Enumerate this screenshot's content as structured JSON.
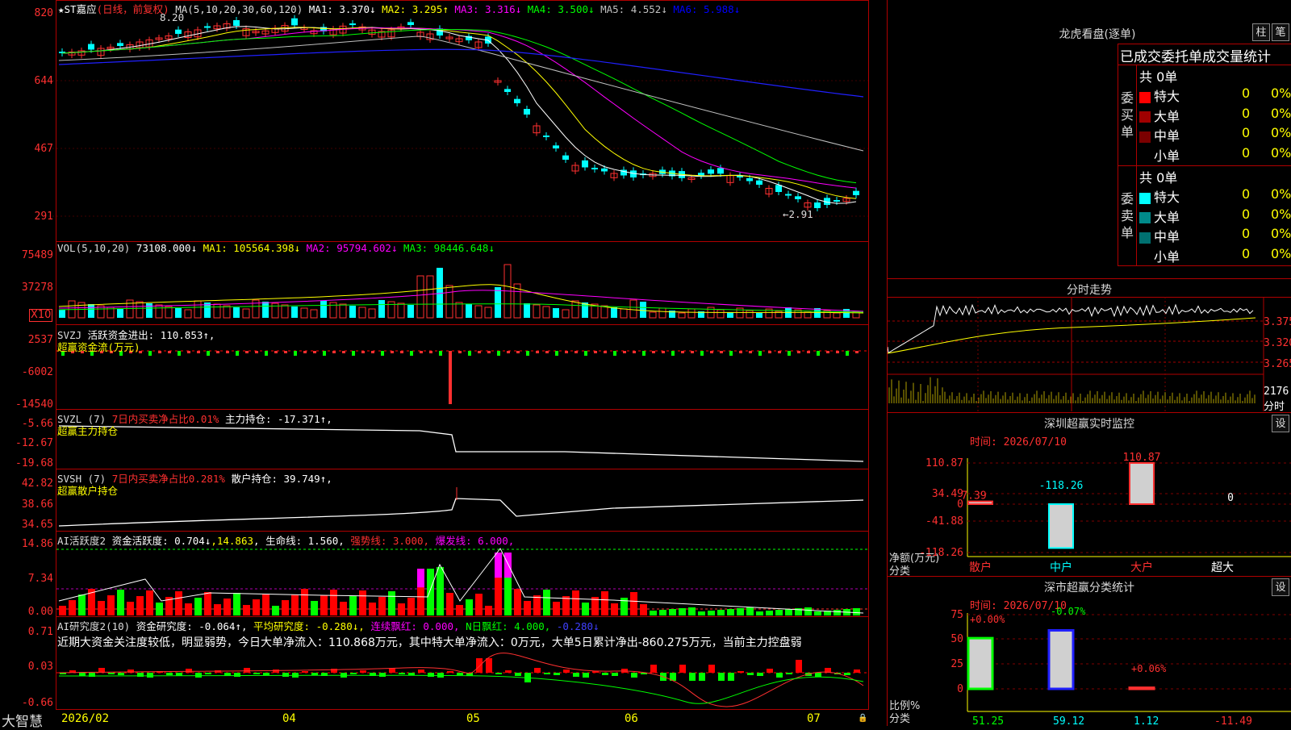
{
  "kline": {
    "name": "ST嘉应",
    "mode": "(日线，前复权)",
    "ma_label": "MA(5,10,20,30,60,120)",
    "ma1": "MA1: 3.370↓",
    "ma2": "MA2: 3.295↑",
    "ma3": "MA3: 3.316↓",
    "ma4": "MA4: 3.500↓",
    "ma5": "MA5: 4.552↓",
    "ma6": "MA6: 5.988↓",
    "yticks": [
      "820",
      "644",
      "467",
      "291"
    ],
    "high_note": "8.20",
    "low_note": "←2.91"
  },
  "vol": {
    "label": "VOL(5,10,20)",
    "v": "73108.000↓",
    "ma1": "MA1: 105564.398↓",
    "ma2": "MA2: 95794.602↓",
    "ma3": "MA3: 98446.648↓",
    "yticks": [
      "75489",
      "37278"
    ],
    "x10": "X10"
  },
  "svzj": {
    "label": "SVZJ",
    "text": "活跃资金进出: 110.853↑,",
    "sub": "超赢资金流(万元)",
    "yticks": [
      "2537",
      "-6002",
      "-14540"
    ]
  },
  "svzl": {
    "label": "SVZL (7)",
    "ratio": "7日内买卖净占比0.01%",
    "hold": "主力持仓: -17.371↑,",
    "sub": "超赢主力持仓",
    "yticks": [
      "-5.66",
      "-12.67",
      "-19.68"
    ]
  },
  "svsh": {
    "label": "SVSH (7)",
    "ratio": "7日内买卖净占比0.281%",
    "hold": "散户持仓: 39.749↑,",
    "sub": "超赢散户持仓",
    "yticks": [
      "42.82",
      "38.66",
      "34.65"
    ]
  },
  "ai1": {
    "label": "AI活跃度2",
    "act": "资金活跃度: 0.704↓",
    "v2": "14.863",
    "life": "生命线: 1.560",
    "strong": "强势线: 3.000",
    "burst": "爆发线: 6.000",
    "yticks": [
      "14.86",
      "7.34",
      "0.00"
    ]
  },
  "ai2": {
    "label": "AI研究度2(10)",
    "res": "资金研究度: -0.064↑",
    "avg": "平均研究度: -0.280↓",
    "red": "连续飘红: 0.000",
    "nred": "N日飘红: 4.000",
    "val": "-0.280↓",
    "comment": "近期大资金关注度较低，明显弱势，今日大单净流入：110.868万元，其中特大单净流入：0万元，大单5日累计净出-860.275万元，当前主力控盘弱",
    "yticks": [
      "0.71",
      "0.03",
      "-0.66"
    ]
  },
  "xaxis": {
    "brand": "大智慧",
    "dates": [
      "2026/02",
      "04",
      "05",
      "06",
      "07"
    ]
  },
  "right": {
    "lhb": {
      "title": "龙虎看盘(逐单)",
      "btn1": "柱",
      "btn2": "笔",
      "header": "已成交委托单成交量统计",
      "buy_label": "委买单",
      "sell_label": "委卖单",
      "buy_total": "共 0单",
      "sell_total": "共 0单",
      "rows_buy": [
        {
          "name": "特大",
          "n": "0",
          "p": "0%",
          "color": "#ff0000"
        },
        {
          "name": "大单",
          "n": "0",
          "p": "0%",
          "color": "#a00000"
        },
        {
          "name": "中单",
          "n": "0",
          "p": "0%",
          "color": "#7a0000"
        },
        {
          "name": "小单",
          "n": "0",
          "p": "0%",
          "color": "#000000"
        }
      ],
      "rows_sell": [
        {
          "name": "特大",
          "n": "0",
          "p": "0%",
          "color": "#00ffff"
        },
        {
          "name": "大单",
          "n": "0",
          "p": "0%",
          "color": "#008a8a"
        },
        {
          "name": "中单",
          "n": "0",
          "p": "0%",
          "color": "#007070"
        },
        {
          "name": "小单",
          "n": "0",
          "p": "0%",
          "color": "#000000"
        }
      ]
    },
    "fenshi": {
      "title": "分时走势",
      "p1": "3.375",
      "p2": "3.320",
      "p3": "3.265",
      "vol": "2176",
      "unit": "分时"
    },
    "monitor": {
      "title": "深圳超赢实时监控",
      "btn": "设",
      "time": "时间: 2026/07/10",
      "yticks": [
        "110.87",
        "34.49",
        "0",
        "-41.88",
        "-118.26"
      ],
      "ylabel": "净额(万元)",
      "xlabel": "分类",
      "cats": [
        "散户",
        "中户",
        "大户",
        "超大"
      ],
      "values": [
        "7.39",
        "-118.26",
        "110.87",
        "0"
      ]
    },
    "classify": {
      "title": "深市超赢分类统计",
      "btn": "设",
      "time": "时间: 2026/07/10",
      "yticks": [
        "75",
        "50",
        "25",
        "0"
      ],
      "ylabel": "比例%",
      "xlabel": "分类",
      "cats": [
        "散户",
        "中户",
        "大户",
        "超大"
      ],
      "values": [
        "51.25",
        "59.12",
        "1.12",
        "-11.49"
      ],
      "changes": [
        "+0.00%",
        "-0.07%",
        "+0.06%"
      ]
    }
  },
  "chart_data": [
    {
      "type": "line",
      "title": "ST嘉应 日K (MA)",
      "series": [
        {
          "name": "MA1",
          "values": [
            7.05,
            7.2,
            7.6,
            7.9,
            8.0,
            7.6,
            7.5,
            7.6,
            7.8,
            7.8,
            7.8,
            7.75,
            7.7,
            6.0,
            4.8,
            3.8,
            3.6,
            3.5,
            3.5,
            3.55,
            3.3,
            3.0,
            3.37
          ]
        },
        {
          "name": "MA6",
          "values": [
            6.9,
            6.95,
            7.0,
            7.05,
            7.1,
            7.15,
            7.2,
            7.25,
            7.3,
            7.35,
            7.3,
            7.2,
            7.1,
            7.0,
            6.9,
            6.8,
            6.7,
            6.6,
            6.5,
            6.4,
            6.3,
            6.15,
            5.99
          ]
        }
      ]
    },
    {
      "type": "bar",
      "title": "深圳超赢实时监控",
      "categories": [
        "散户",
        "中户",
        "大户",
        "超大"
      ],
      "values": [
        7.39,
        -118.26,
        110.87,
        0
      ]
    },
    {
      "type": "bar",
      "title": "深市超赢分类统计",
      "categories": [
        "散户",
        "中户",
        "大户",
        "超大"
      ],
      "values": [
        51.25,
        59.12,
        1.12,
        -11.49
      ]
    }
  ]
}
